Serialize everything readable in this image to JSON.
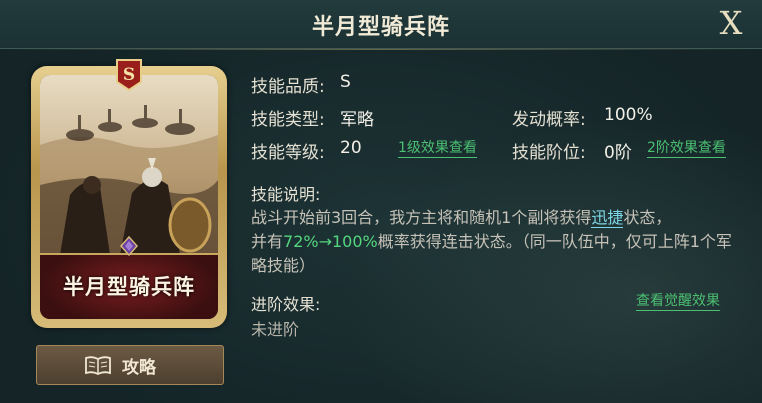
{
  "header": {
    "title": "半月型骑兵阵",
    "close_label": "X"
  },
  "card": {
    "grade_badge": "S",
    "name": "半月型骑兵阵"
  },
  "guide_button": {
    "label": "攻略",
    "icon": "book-icon"
  },
  "skill": {
    "quality_label": "技能品质:",
    "quality_value": "S",
    "type_label": "技能类型:",
    "type_value": "军略",
    "trigger_label": "发动概率:",
    "trigger_value": "100%",
    "level_label": "技能等级:",
    "level_value": "20",
    "level_link": "1级效果查看",
    "tier_label": "技能阶位:",
    "tier_value": "0阶",
    "tier_link": "2阶效果查看",
    "desc_label": "技能说明:",
    "desc_part1": "战斗开始前3回合，我方主将和随机1个副将获得",
    "desc_keyword": "迅捷",
    "desc_part2": "状态，",
    "desc_part3": "并有",
    "desc_chance": "72%→100%",
    "desc_part4": "概率获得连击状态。（同一队伍中，仅可上阵1个军略技能）",
    "advance_label": "进阶效果:",
    "advance_link": "查看觉醒效果",
    "advance_value": "未进阶"
  },
  "colors": {
    "accent_green": "#4bbf72",
    "keyword_cyan": "#7ed7e6",
    "gold": "#c9a85e"
  }
}
